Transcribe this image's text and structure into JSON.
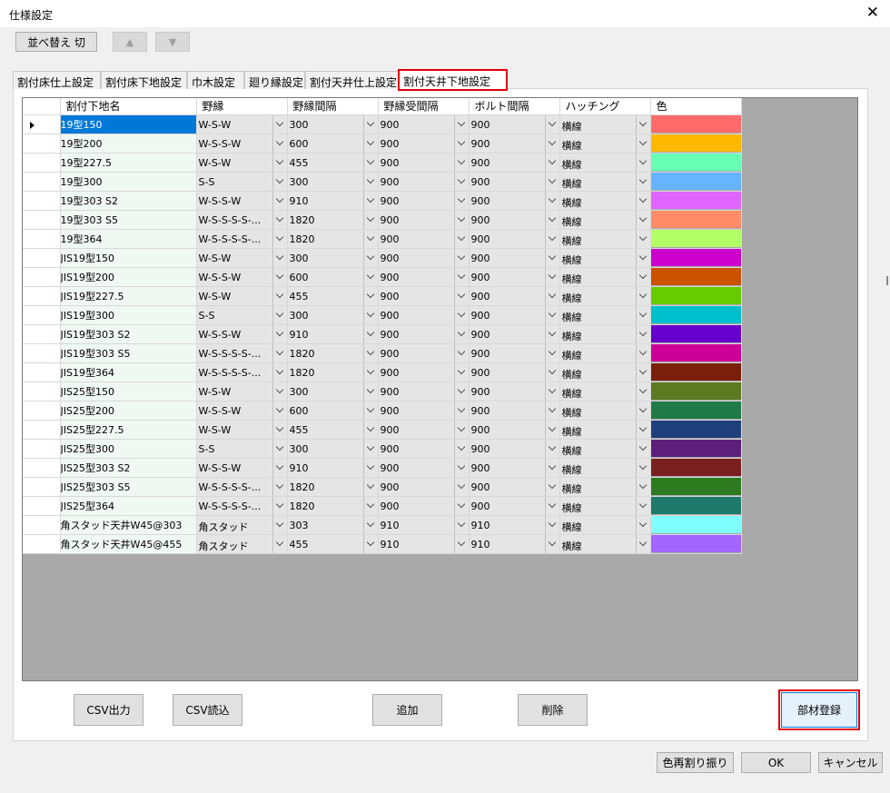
{
  "window": {
    "title": "仕様設定",
    "close_glyph": "✕"
  },
  "toolbar": {
    "sort_label": "並べ替え 切",
    "up_glyph": "▲",
    "down_glyph": "▼"
  },
  "tabs": [
    "割付床仕上設定",
    "割付床下地設定",
    "巾木設定",
    "廻り縁設定",
    "割付天井仕上設定",
    "割付天井下地設定"
  ],
  "active_tab_index": 5,
  "columns": [
    "割付下地名",
    "野縁",
    "野縁間隔",
    "野縁受間隔",
    "ボルト間隔",
    "ハッチング",
    "色"
  ],
  "rows": [
    {
      "name": "19型150",
      "noen": "W-S-W",
      "kankaku": "300",
      "uke": "900",
      "bolt": "900",
      "hatch": "横線",
      "color": "#ff6b6b"
    },
    {
      "name": "19型200",
      "noen": "W-S-S-W",
      "kankaku": "600",
      "uke": "900",
      "bolt": "900",
      "hatch": "横線",
      "color": "#ffb800"
    },
    {
      "name": "19型227.5",
      "noen": "W-S-W",
      "kankaku": "455",
      "uke": "900",
      "bolt": "900",
      "hatch": "横線",
      "color": "#66ffb3"
    },
    {
      "name": "19型300",
      "noen": "S-S",
      "kankaku": "300",
      "uke": "900",
      "bolt": "900",
      "hatch": "横線",
      "color": "#66b3ff"
    },
    {
      "name": "19型303 S2",
      "noen": "W-S-S-W",
      "kankaku": "910",
      "uke": "900",
      "bolt": "900",
      "hatch": "横線",
      "color": "#e066ff"
    },
    {
      "name": "19型303 S5",
      "noen": "W-S-S-S-S-...",
      "kankaku": "1820",
      "uke": "900",
      "bolt": "900",
      "hatch": "横線",
      "color": "#ff8c66"
    },
    {
      "name": "19型364",
      "noen": "W-S-S-S-S-...",
      "kankaku": "1820",
      "uke": "900",
      "bolt": "900",
      "hatch": "横線",
      "color": "#b3ff66"
    },
    {
      "name": "JIS19型150",
      "noen": "W-S-W",
      "kankaku": "300",
      "uke": "900",
      "bolt": "900",
      "hatch": "横線",
      "color": "#cc00cc"
    },
    {
      "name": "JIS19型200",
      "noen": "W-S-S-W",
      "kankaku": "600",
      "uke": "900",
      "bolt": "900",
      "hatch": "横線",
      "color": "#cc5200"
    },
    {
      "name": "JIS19型227.5",
      "noen": "W-S-W",
      "kankaku": "455",
      "uke": "900",
      "bolt": "900",
      "hatch": "横線",
      "color": "#66cc00"
    },
    {
      "name": "JIS19型300",
      "noen": "S-S",
      "kankaku": "300",
      "uke": "900",
      "bolt": "900",
      "hatch": "横線",
      "color": "#00bfcc"
    },
    {
      "name": "JIS19型303 S2",
      "noen": "W-S-S-W",
      "kankaku": "910",
      "uke": "900",
      "bolt": "900",
      "hatch": "横線",
      "color": "#6600cc"
    },
    {
      "name": "JIS19型303 S5",
      "noen": "W-S-S-S-S-...",
      "kankaku": "1820",
      "uke": "900",
      "bolt": "900",
      "hatch": "横線",
      "color": "#cc0099"
    },
    {
      "name": "JIS19型364",
      "noen": "W-S-S-S-S-...",
      "kankaku": "1820",
      "uke": "900",
      "bolt": "900",
      "hatch": "横線",
      "color": "#7a1f0a"
    },
    {
      "name": "JIS25型150",
      "noen": "W-S-W",
      "kankaku": "300",
      "uke": "900",
      "bolt": "900",
      "hatch": "横線",
      "color": "#5c7a1f"
    },
    {
      "name": "JIS25型200",
      "noen": "W-S-S-W",
      "kankaku": "600",
      "uke": "900",
      "bolt": "900",
      "hatch": "横線",
      "color": "#1f7a47"
    },
    {
      "name": "JIS25型227.5",
      "noen": "W-S-W",
      "kankaku": "455",
      "uke": "900",
      "bolt": "900",
      "hatch": "横線",
      "color": "#1f3f7a"
    },
    {
      "name": "JIS25型300",
      "noen": "S-S",
      "kankaku": "300",
      "uke": "900",
      "bolt": "900",
      "hatch": "横線",
      "color": "#5c1f7a"
    },
    {
      "name": "JIS25型303 S2",
      "noen": "W-S-S-W",
      "kankaku": "910",
      "uke": "900",
      "bolt": "900",
      "hatch": "横線",
      "color": "#7a1f1f"
    },
    {
      "name": "JIS25型303 S5",
      "noen": "W-S-S-S-S-...",
      "kankaku": "1820",
      "uke": "900",
      "bolt": "900",
      "hatch": "横線",
      "color": "#2e7a1f"
    },
    {
      "name": "JIS25型364",
      "noen": "W-S-S-S-S-...",
      "kankaku": "1820",
      "uke": "900",
      "bolt": "900",
      "hatch": "横線",
      "color": "#1f7a6b"
    },
    {
      "name": "角スタッド天井W45@303",
      "noen": "角スタッド",
      "kankaku": "303",
      "uke": "910",
      "bolt": "910",
      "hatch": "横線",
      "color": "#80ffff"
    },
    {
      "name": "角スタッド天井W45@455",
      "noen": "角スタッド",
      "kankaku": "455",
      "uke": "910",
      "bolt": "910",
      "hatch": "横線",
      "color": "#a366ff"
    }
  ],
  "selected_row_index": 0,
  "buttons": {
    "csv_out": "CSV出力",
    "csv_in": "CSV読込",
    "add": "追加",
    "delete": "削除",
    "register": "部材登録",
    "recolor": "色再割り振り",
    "ok": "OK",
    "cancel": "キャンセル"
  }
}
